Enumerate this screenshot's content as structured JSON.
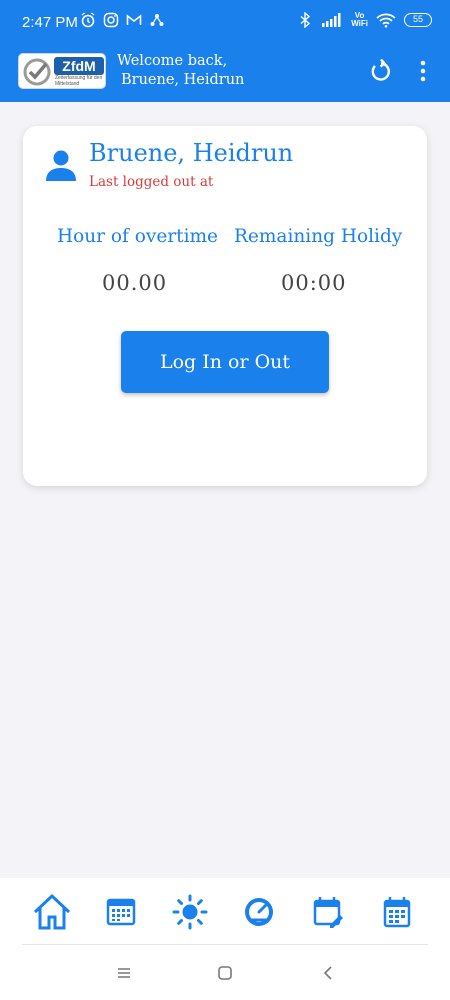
{
  "status_bar": {
    "time": "2:47 PM",
    "vowifi_top": "Vo",
    "vowifi_bottom": "WiFi",
    "battery": "55"
  },
  "app_bar": {
    "logo_text": "ZfdM",
    "logo_subtext": "Zeiterfassung für den Mittelstand",
    "welcome_line1": "Welcome back,",
    "welcome_line2": "Bruene, Heidrun",
    "color": "#1a80ec"
  },
  "card": {
    "user_name": "Bruene, Heidrun",
    "last_logout": "Last logged out at",
    "overtime_label": "Hour of overtime",
    "overtime_value": "00.00",
    "holiday_label": "Remaining Holidy",
    "holiday_value": "00:00",
    "button_label": "Log In or Out",
    "accent": "#1a80ec",
    "warning_color": "#d63c3c"
  },
  "bottom_nav": {
    "items": [
      "home-icon",
      "calendar-grid-icon",
      "sun-icon",
      "speedometer-icon",
      "calendar-edit-icon",
      "calendar-icon"
    ]
  },
  "system_nav": {
    "items": [
      "menu-icon",
      "home-square-icon",
      "back-icon"
    ]
  }
}
